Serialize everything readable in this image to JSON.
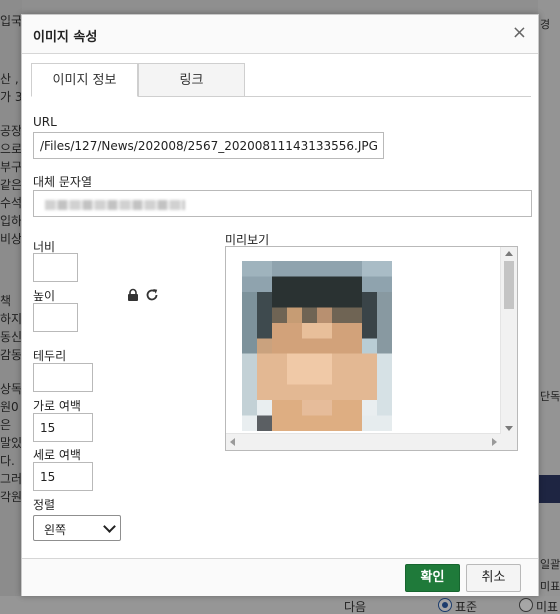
{
  "dialog": {
    "title": "이미지 속성",
    "close_symbol": "×",
    "tabs": [
      {
        "label": "이미지 정보",
        "active": true
      },
      {
        "label": "링크",
        "active": false
      }
    ],
    "url_label": "URL",
    "url_value": "/Files/127/News/202008/2567_20200811143133556.JPG",
    "alt_label": "대체 문자열",
    "width_label": "너비",
    "width_value": "",
    "height_label": "높이",
    "border_label": "테두리",
    "border_value": "",
    "hspace_label": "가로 여백",
    "hspace_value": "15",
    "vspace_label": "세로 여백",
    "vspace_value": "15",
    "align_label": "정렬",
    "align_value": "왼쪽",
    "preview_label": "미리보기",
    "lock_icon": "lock-icon",
    "reset_icon": "refresh-icon"
  },
  "footer": {
    "ok_label": "확인",
    "cancel_label": "취소"
  },
  "colors": {
    "ok_button": "#1f7a3a",
    "overlay": "rgba(0,0,0,0.35)",
    "background_navy": "#2f3a66"
  },
  "background_text": {
    "left": [
      "입국",
      "산 ,",
      "가 3",
      "공장",
      "으로",
      "부구",
      "같은",
      "수석",
      "입하",
      "비상C",
      "책",
      "하지",
      "동신",
      "감동",
      "상독",
      "원0",
      "은",
      "말있",
      "다.",
      "그러",
      "각원"
    ],
    "right": [
      "경",
      "단독",
      "일괄",
      "미표"
    ],
    "bottom": [
      "다음",
      "표준",
      "미표"
    ]
  }
}
